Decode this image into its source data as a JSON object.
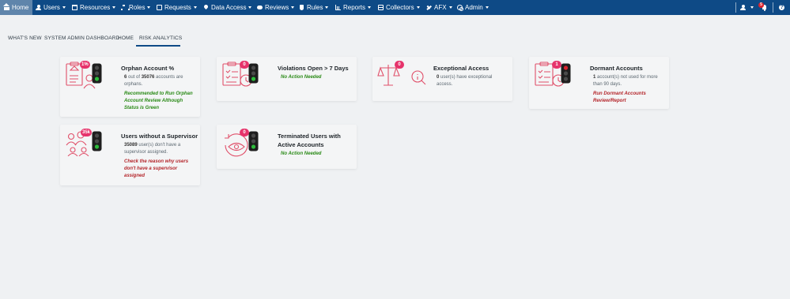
{
  "nav": {
    "items": [
      {
        "label": "Home",
        "icon": "home-icon"
      },
      {
        "label": "Users",
        "icon": "user-icon"
      },
      {
        "label": "Resources",
        "icon": "bank-icon"
      },
      {
        "label": "Roles",
        "icon": "sitemap-icon"
      },
      {
        "label": "Requests",
        "icon": "box-icon"
      },
      {
        "label": "Data Access",
        "icon": "pin-icon"
      },
      {
        "label": "Reviews",
        "icon": "reviews-icon"
      },
      {
        "label": "Rules",
        "icon": "shield-icon"
      },
      {
        "label": "Reports",
        "icon": "chart-icon"
      },
      {
        "label": "Collectors",
        "icon": "card-icon"
      },
      {
        "label": "AFX",
        "icon": "plane-icon"
      },
      {
        "label": "Admin",
        "icon": "cogs-icon"
      }
    ],
    "notification_count": "5"
  },
  "tabs": [
    "WHAT'S NEW",
    "SYSTEM ADMIN DASHBOARD",
    "HOME",
    "RISK ANALYTICS"
  ],
  "active_tab": "RISK ANALYTICS",
  "cards": {
    "orphan": {
      "title": "Orphan Account %",
      "badge": "1%",
      "count": "6",
      "total": "35076",
      "text_a": " out of ",
      "text_b": " accounts are orphans.",
      "recommendation": "Recommended to Run Orphan Account Review Although Status is Green",
      "rec_color": "#2a8a17"
    },
    "violations": {
      "title": "Violations Open > 7 Days",
      "badge": "0",
      "recommendation": "No Action Needed",
      "rec_color": "#2a8a17"
    },
    "exceptional": {
      "title": "Exceptional Access",
      "badge": "0",
      "count": "0",
      "text": " user(s) have exceptional access."
    },
    "dormant": {
      "title": "Dormant Accounts",
      "badge": "1",
      "count": "1",
      "text": " account(s) not used for more than 90 days.",
      "recommendation": "Run Dormant Accounts Review/Report",
      "rec_color": "#b4262b"
    },
    "supervisor": {
      "title": "Users without a Supervisor",
      "badge": "35k",
      "count": "35089",
      "text": " user(s) don't have a supervisor assigned.",
      "recommendation": "Check the reason why users don't have a supervisor assigned",
      "rec_color": "#b4262b"
    },
    "terminated": {
      "title": "Terminated Users with Active Accounts",
      "badge": "0",
      "recommendation": "No Action Needed",
      "rec_color": "#2a8a17"
    }
  },
  "colors": {
    "navbar": "#0e4a86",
    "nav_active": "#5f85ab",
    "badge": "#e6336b",
    "illustration": "#e0506a",
    "light_red": "#d9242f",
    "light_amber": "#f2a516",
    "light_green": "#2dbb3b"
  }
}
